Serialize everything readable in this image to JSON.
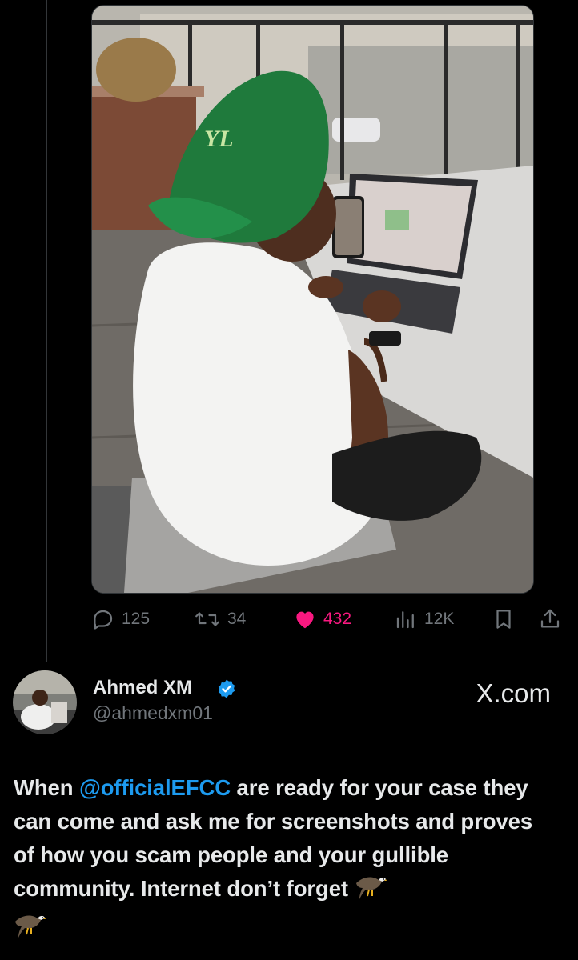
{
  "tweet": {
    "media_alt": "",
    "stats": {
      "replies": "125",
      "reposts": "34",
      "likes": "432",
      "views": "12K"
    },
    "author": {
      "display_name": "Ahmed XM",
      "handle": "@ahmedxm01",
      "verified": true
    },
    "watermark": "X.com",
    "text": {
      "prefix": "When ",
      "mention": "@officialEFCC",
      "body": " are ready for your case they can come and ask me for screenshots and proves of how you scam people and your gullible community. Internet don’t forget "
    },
    "emojis": [
      "eagle-icon",
      "eagle-icon"
    ]
  },
  "colors": {
    "background": "#000000",
    "text": "#e7e9ea",
    "muted": "#71767b",
    "like": "#f91880",
    "link": "#1d9bf0",
    "verified": "#1d9bf0"
  }
}
